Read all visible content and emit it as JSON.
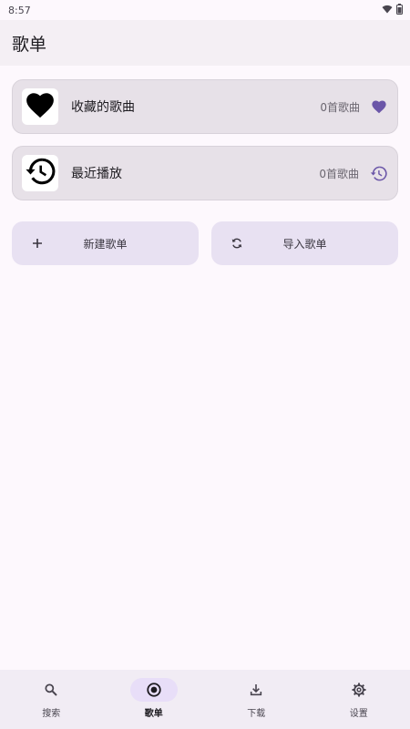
{
  "status_bar": {
    "time": "8:57",
    "icons": [
      "wifi-icon",
      "battery-icon"
    ]
  },
  "header": {
    "title": "歌单"
  },
  "playlists": [
    {
      "title": "收藏的歌曲",
      "count": "0首歌曲",
      "thumb_icon": "heart-icon",
      "end_icon": "heart-icon"
    },
    {
      "title": "最近播放",
      "count": "0首歌曲",
      "thumb_icon": "history-icon",
      "end_icon": "history-icon"
    }
  ],
  "actions": [
    {
      "label": "新建歌单",
      "icon": "plus-icon"
    },
    {
      "label": "导入歌单",
      "icon": "sync-icon"
    }
  ],
  "nav": [
    {
      "label": "搜索",
      "icon": "search-icon",
      "active": false
    },
    {
      "label": "歌单",
      "icon": "record-icon",
      "active": true
    },
    {
      "label": "下载",
      "icon": "download-icon",
      "active": false
    },
    {
      "label": "设置",
      "icon": "gear-icon",
      "active": false
    }
  ],
  "colors": {
    "accent": "#6b56a8",
    "nav_active_pill": "#e8def8",
    "card_bg": "#e7e1e8",
    "button_bg": "#e8e1f2"
  }
}
